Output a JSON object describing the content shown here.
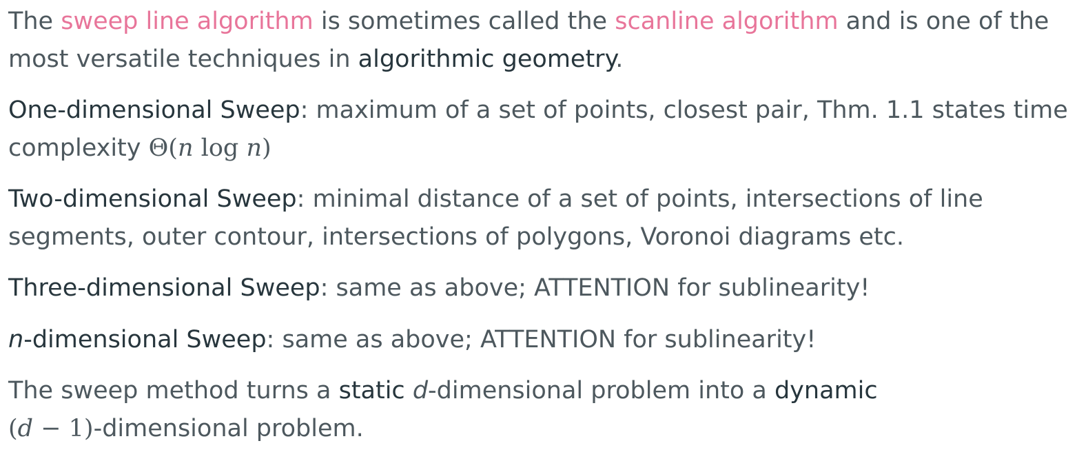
{
  "intro": {
    "t1": "The ",
    "hl1": "sweep line algorithm",
    "t2": " is sometimes called the ",
    "hl2": "scanline algorithm",
    "t3": " and is one of the",
    "t4": "most versatile techniques in ",
    "strong1": "algorithmic geometry",
    "t5": "."
  },
  "one_dim": {
    "term": "One-dimensional Sweep",
    "colon": ":",
    "text_line1": " maximum of a set of points, closest pair, Thm. 1.1 states time",
    "text_line2": "complexity ",
    "math_theta": "Θ(",
    "math_n1": "n",
    "math_log": " log ",
    "math_n2": "n",
    "math_close": ")"
  },
  "two_dim": {
    "term": "Two-dimensional Sweep",
    "colon": ":",
    "text_line1": " minimal distance of a set of points, intersections of line",
    "text_line2": "segments, outer contour, intersections of polygons, Voronoi diagrams etc."
  },
  "three_dim": {
    "term": "Three-dimensional Sweep",
    "colon": ":",
    "text": " same as above; ATTENTION for sublinearity!"
  },
  "n_dim": {
    "term_var": "n",
    "term": "-dimensional Sweep",
    "colon": ":",
    "text": " same as above; ATTENTION for sublinearity!"
  },
  "summary": {
    "t1": "The sweep method turns a ",
    "strong1": "static",
    "t2": " ",
    "var_d": "d",
    "t3": "-dimensional problem into a ",
    "strong2": "dynamic",
    "math_open": "(",
    "math_d": "d",
    "math_minus": " − 1)",
    "t4": "-dimensional problem."
  }
}
